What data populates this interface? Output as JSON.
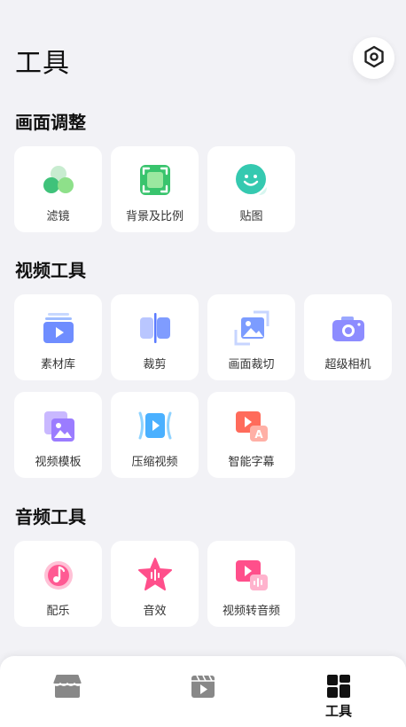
{
  "header": {
    "title": "工具"
  },
  "sections": [
    {
      "title": "画面调整",
      "items": [
        {
          "label": "滤镜",
          "icon": "filter-icon"
        },
        {
          "label": "背景及比例",
          "icon": "background-ratio-icon"
        },
        {
          "label": "贴图",
          "icon": "sticker-icon"
        }
      ]
    },
    {
      "title": "视频工具",
      "items": [
        {
          "label": "素材库",
          "icon": "material-library-icon"
        },
        {
          "label": "裁剪",
          "icon": "trim-icon"
        },
        {
          "label": "画面裁切",
          "icon": "crop-icon"
        },
        {
          "label": "超级相机",
          "icon": "camera-icon"
        },
        {
          "label": "视频模板",
          "icon": "template-icon"
        },
        {
          "label": "压缩视频",
          "icon": "compress-icon"
        },
        {
          "label": "智能字幕",
          "icon": "auto-subtitle-icon"
        }
      ]
    },
    {
      "title": "音频工具",
      "items": [
        {
          "label": "配乐",
          "icon": "music-icon"
        },
        {
          "label": "音效",
          "icon": "sound-effect-icon"
        },
        {
          "label": "视频转音频",
          "icon": "video-to-audio-icon"
        }
      ]
    }
  ],
  "bottom_nav": [
    {
      "label": "",
      "icon": "store-icon"
    },
    {
      "label": "",
      "icon": "video-icon"
    },
    {
      "label": "工具",
      "icon": "tools-icon",
      "active": true
    }
  ]
}
